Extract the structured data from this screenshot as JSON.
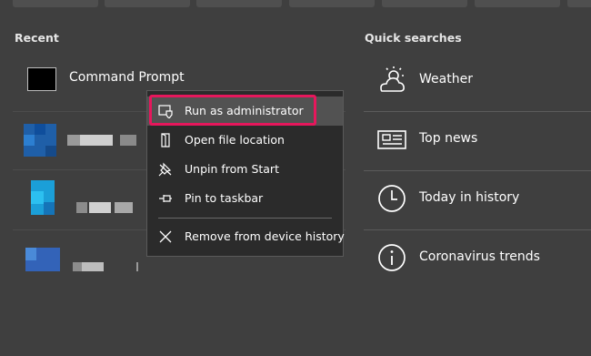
{
  "recent": {
    "title": "Recent",
    "items": [
      {
        "label": "Command Prompt"
      }
    ]
  },
  "context_menu": {
    "items": [
      {
        "label": "Run as administrator",
        "icon": "shield-icon"
      },
      {
        "label": "Open file location",
        "icon": "file-location-icon"
      },
      {
        "label": "Unpin from Start",
        "icon": "unpin-icon"
      },
      {
        "label": "Pin to taskbar",
        "icon": "pin-icon"
      },
      {
        "label": "Remove from device history",
        "icon": "close-icon"
      }
    ]
  },
  "quick_searches": {
    "title": "Quick searches",
    "items": [
      {
        "label": "Weather",
        "icon": "weather-icon"
      },
      {
        "label": "Top news",
        "icon": "news-icon"
      },
      {
        "label": "Today in history",
        "icon": "clock-icon"
      },
      {
        "label": "Coronavirus trends",
        "icon": "info-icon"
      }
    ]
  },
  "colors": {
    "background": "#3f3f3f",
    "menu_background": "#2b2b2b",
    "highlight_border": "#e6175c"
  }
}
